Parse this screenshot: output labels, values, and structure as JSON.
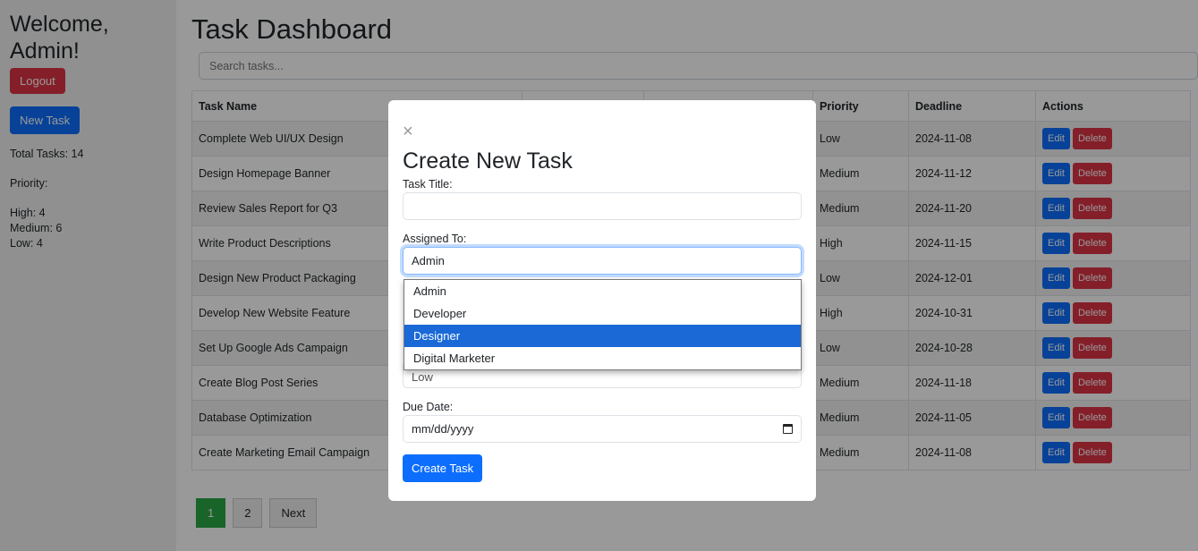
{
  "sidebar": {
    "welcome": "Welcome, Admin!",
    "logout": "Logout",
    "new_task": "New Task",
    "total": "Total Tasks: 14",
    "priority": "Priority:",
    "high": "High: 4",
    "medium": "Medium: 6",
    "low": "Low: 4"
  },
  "main": {
    "title": "Task Dashboard",
    "search_placeholder": "Search tasks...",
    "headers": {
      "name": "Task Name",
      "priority": "Priority",
      "deadline": "Deadline",
      "actions": "Actions"
    },
    "edit": "Edit",
    "delete": "Delete",
    "rows": [
      {
        "name": "Complete Web UI/UX Design",
        "priority": "Low",
        "deadline": "2024-11-08"
      },
      {
        "name": "Design Homepage Banner",
        "priority": "Medium",
        "deadline": "2024-11-12"
      },
      {
        "name": "Review Sales Report for Q3",
        "priority": "Medium",
        "deadline": "2024-11-20"
      },
      {
        "name": "Write Product Descriptions",
        "priority": "High",
        "deadline": "2024-11-15"
      },
      {
        "name": "Design New Product Packaging",
        "priority": "Low",
        "deadline": "2024-12-01"
      },
      {
        "name": "Develop New Website Feature",
        "priority": "High",
        "deadline": "2024-10-31"
      },
      {
        "name": "Set Up Google Ads Campaign",
        "priority": "Low",
        "deadline": "2024-10-28"
      },
      {
        "name": "Create Blog Post Series",
        "priority": "Medium",
        "deadline": "2024-11-18"
      },
      {
        "name": "Database Optimization",
        "priority": "Medium",
        "deadline": "2024-11-05"
      },
      {
        "name": "Create Marketing Email Campaign",
        "priority": "Medium",
        "deadline": "2024-11-08"
      }
    ],
    "pagination": [
      "1",
      "2",
      "Next"
    ]
  },
  "modal": {
    "close": "×",
    "title": "Create New Task",
    "task_title_label": "Task Title:",
    "assigned_label": "Assigned To:",
    "assigned_value": "Admin",
    "options": [
      "Admin",
      "Developer",
      "Designer",
      "Digital Marketer"
    ],
    "priority_value": "Low",
    "due_label": "Due Date:",
    "due_placeholder": "mm/dd/yyyy",
    "create": "Create Task"
  }
}
